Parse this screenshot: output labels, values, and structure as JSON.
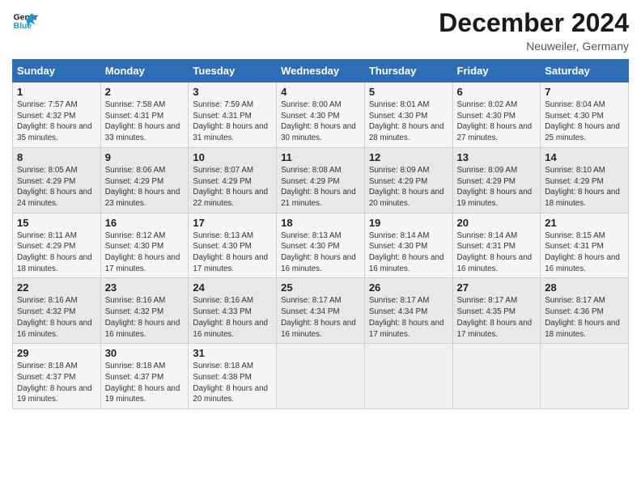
{
  "header": {
    "logo_line1": "General",
    "logo_line2": "Blue",
    "month": "December 2024",
    "location": "Neuweiler, Germany"
  },
  "days_of_week": [
    "Sunday",
    "Monday",
    "Tuesday",
    "Wednesday",
    "Thursday",
    "Friday",
    "Saturday"
  ],
  "weeks": [
    [
      {
        "day": "1",
        "rise": "7:57 AM",
        "set": "4:32 PM",
        "daylight": "8 hours and 35 minutes."
      },
      {
        "day": "2",
        "rise": "7:58 AM",
        "set": "4:31 PM",
        "daylight": "8 hours and 33 minutes."
      },
      {
        "day": "3",
        "rise": "7:59 AM",
        "set": "4:31 PM",
        "daylight": "8 hours and 31 minutes."
      },
      {
        "day": "4",
        "rise": "8:00 AM",
        "set": "4:30 PM",
        "daylight": "8 hours and 30 minutes."
      },
      {
        "day": "5",
        "rise": "8:01 AM",
        "set": "4:30 PM",
        "daylight": "8 hours and 28 minutes."
      },
      {
        "day": "6",
        "rise": "8:02 AM",
        "set": "4:30 PM",
        "daylight": "8 hours and 27 minutes."
      },
      {
        "day": "7",
        "rise": "8:04 AM",
        "set": "4:30 PM",
        "daylight": "8 hours and 25 minutes."
      }
    ],
    [
      {
        "day": "8",
        "rise": "8:05 AM",
        "set": "4:29 PM",
        "daylight": "8 hours and 24 minutes."
      },
      {
        "day": "9",
        "rise": "8:06 AM",
        "set": "4:29 PM",
        "daylight": "8 hours and 23 minutes."
      },
      {
        "day": "10",
        "rise": "8:07 AM",
        "set": "4:29 PM",
        "daylight": "8 hours and 22 minutes."
      },
      {
        "day": "11",
        "rise": "8:08 AM",
        "set": "4:29 PM",
        "daylight": "8 hours and 21 minutes."
      },
      {
        "day": "12",
        "rise": "8:09 AM",
        "set": "4:29 PM",
        "daylight": "8 hours and 20 minutes."
      },
      {
        "day": "13",
        "rise": "8:09 AM",
        "set": "4:29 PM",
        "daylight": "8 hours and 19 minutes."
      },
      {
        "day": "14",
        "rise": "8:10 AM",
        "set": "4:29 PM",
        "daylight": "8 hours and 18 minutes."
      }
    ],
    [
      {
        "day": "15",
        "rise": "8:11 AM",
        "set": "4:29 PM",
        "daylight": "8 hours and 18 minutes."
      },
      {
        "day": "16",
        "rise": "8:12 AM",
        "set": "4:30 PM",
        "daylight": "8 hours and 17 minutes."
      },
      {
        "day": "17",
        "rise": "8:13 AM",
        "set": "4:30 PM",
        "daylight": "8 hours and 17 minutes."
      },
      {
        "day": "18",
        "rise": "8:13 AM",
        "set": "4:30 PM",
        "daylight": "8 hours and 16 minutes."
      },
      {
        "day": "19",
        "rise": "8:14 AM",
        "set": "4:30 PM",
        "daylight": "8 hours and 16 minutes."
      },
      {
        "day": "20",
        "rise": "8:14 AM",
        "set": "4:31 PM",
        "daylight": "8 hours and 16 minutes."
      },
      {
        "day": "21",
        "rise": "8:15 AM",
        "set": "4:31 PM",
        "daylight": "8 hours and 16 minutes."
      }
    ],
    [
      {
        "day": "22",
        "rise": "8:16 AM",
        "set": "4:32 PM",
        "daylight": "8 hours and 16 minutes."
      },
      {
        "day": "23",
        "rise": "8:16 AM",
        "set": "4:32 PM",
        "daylight": "8 hours and 16 minutes."
      },
      {
        "day": "24",
        "rise": "8:16 AM",
        "set": "4:33 PM",
        "daylight": "8 hours and 16 minutes."
      },
      {
        "day": "25",
        "rise": "8:17 AM",
        "set": "4:34 PM",
        "daylight": "8 hours and 16 minutes."
      },
      {
        "day": "26",
        "rise": "8:17 AM",
        "set": "4:34 PM",
        "daylight": "8 hours and 17 minutes."
      },
      {
        "day": "27",
        "rise": "8:17 AM",
        "set": "4:35 PM",
        "daylight": "8 hours and 17 minutes."
      },
      {
        "day": "28",
        "rise": "8:17 AM",
        "set": "4:36 PM",
        "daylight": "8 hours and 18 minutes."
      }
    ],
    [
      {
        "day": "29",
        "rise": "8:18 AM",
        "set": "4:37 PM",
        "daylight": "8 hours and 19 minutes."
      },
      {
        "day": "30",
        "rise": "8:18 AM",
        "set": "4:37 PM",
        "daylight": "8 hours and 19 minutes."
      },
      {
        "day": "31",
        "rise": "8:18 AM",
        "set": "4:38 PM",
        "daylight": "8 hours and 20 minutes."
      },
      null,
      null,
      null,
      null
    ]
  ]
}
